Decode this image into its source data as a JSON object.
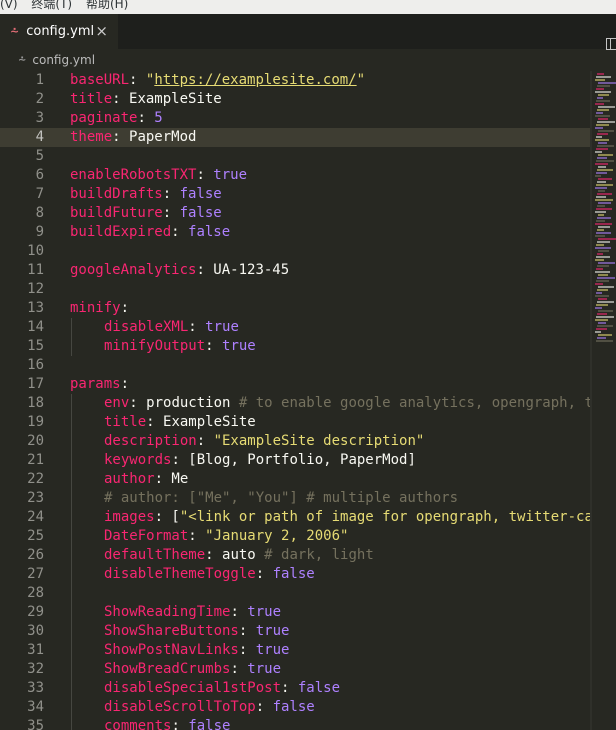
{
  "menubar": {
    "items": [
      "(V)",
      "终端(T)",
      "帮助(H)"
    ]
  },
  "tab": {
    "icon": "yaml-icon",
    "label": "config.yml",
    "close": "×"
  },
  "breadcrumb": {
    "icon": "yaml-icon",
    "label": "config.yml"
  },
  "editor": {
    "current_line": 4,
    "lines": [
      {
        "n": "1",
        "indent": 0,
        "tokens": [
          [
            "key",
            "baseURL"
          ],
          [
            "plain",
            ": "
          ],
          [
            "str",
            "\""
          ],
          [
            "url",
            "https://examplesite.com/"
          ],
          [
            "str",
            "\""
          ]
        ]
      },
      {
        "n": "2",
        "indent": 0,
        "tokens": [
          [
            "key",
            "title"
          ],
          [
            "plain",
            ": ExampleSite"
          ]
        ]
      },
      {
        "n": "3",
        "indent": 0,
        "tokens": [
          [
            "key",
            "paginate"
          ],
          [
            "plain",
            ": "
          ],
          [
            "num",
            "5"
          ]
        ]
      },
      {
        "n": "4",
        "indent": 0,
        "tokens": [
          [
            "key",
            "theme"
          ],
          [
            "plain",
            ": PaperMod"
          ]
        ]
      },
      {
        "n": "5",
        "indent": 0,
        "tokens": []
      },
      {
        "n": "6",
        "indent": 0,
        "tokens": [
          [
            "key",
            "enableRobotsTXT"
          ],
          [
            "plain",
            ": "
          ],
          [
            "num",
            "true"
          ]
        ]
      },
      {
        "n": "7",
        "indent": 0,
        "tokens": [
          [
            "key",
            "buildDrafts"
          ],
          [
            "plain",
            ": "
          ],
          [
            "num",
            "false"
          ]
        ]
      },
      {
        "n": "8",
        "indent": 0,
        "tokens": [
          [
            "key",
            "buildFuture"
          ],
          [
            "plain",
            ": "
          ],
          [
            "num",
            "false"
          ]
        ]
      },
      {
        "n": "9",
        "indent": 0,
        "tokens": [
          [
            "key",
            "buildExpired"
          ],
          [
            "plain",
            ": "
          ],
          [
            "num",
            "false"
          ]
        ]
      },
      {
        "n": "10",
        "indent": 0,
        "tokens": []
      },
      {
        "n": "11",
        "indent": 0,
        "tokens": [
          [
            "key",
            "googleAnalytics"
          ],
          [
            "plain",
            ": UA-123-45"
          ]
        ]
      },
      {
        "n": "12",
        "indent": 0,
        "tokens": []
      },
      {
        "n": "13",
        "indent": 0,
        "tokens": [
          [
            "key",
            "minify"
          ],
          [
            "plain",
            ":"
          ]
        ]
      },
      {
        "n": "14",
        "indent": 1,
        "tokens": [
          [
            "key",
            "disableXML"
          ],
          [
            "plain",
            ": "
          ],
          [
            "num",
            "true"
          ]
        ]
      },
      {
        "n": "15",
        "indent": 1,
        "tokens": [
          [
            "key",
            "minifyOutput"
          ],
          [
            "plain",
            ": "
          ],
          [
            "num",
            "true"
          ]
        ]
      },
      {
        "n": "16",
        "indent": 0,
        "tokens": []
      },
      {
        "n": "17",
        "indent": 0,
        "tokens": [
          [
            "key",
            "params"
          ],
          [
            "plain",
            ":"
          ]
        ]
      },
      {
        "n": "18",
        "indent": 1,
        "tokens": [
          [
            "key",
            "env"
          ],
          [
            "plain",
            ": production "
          ],
          [
            "com",
            "# to enable google analytics, opengraph, t"
          ]
        ]
      },
      {
        "n": "19",
        "indent": 1,
        "tokens": [
          [
            "key",
            "title"
          ],
          [
            "plain",
            ": ExampleSite"
          ]
        ]
      },
      {
        "n": "20",
        "indent": 1,
        "tokens": [
          [
            "key",
            "description"
          ],
          [
            "plain",
            ": "
          ],
          [
            "str",
            "\"ExampleSite description\""
          ]
        ]
      },
      {
        "n": "21",
        "indent": 1,
        "tokens": [
          [
            "key",
            "keywords"
          ],
          [
            "plain",
            ": [Blog, Portfolio, PaperMod]"
          ]
        ]
      },
      {
        "n": "22",
        "indent": 1,
        "tokens": [
          [
            "key",
            "author"
          ],
          [
            "plain",
            ": Me"
          ]
        ]
      },
      {
        "n": "23",
        "indent": 1,
        "tokens": [
          [
            "com",
            "# author: [\"Me\", \"You\"] # multiple authors"
          ]
        ]
      },
      {
        "n": "24",
        "indent": 1,
        "tokens": [
          [
            "key",
            "images"
          ],
          [
            "plain",
            ": ["
          ],
          [
            "str",
            "\"<link or path of image for opengraph, twitter-ca"
          ]
        ]
      },
      {
        "n": "25",
        "indent": 1,
        "tokens": [
          [
            "key",
            "DateFormat"
          ],
          [
            "plain",
            ": "
          ],
          [
            "str",
            "\"January 2, 2006\""
          ]
        ]
      },
      {
        "n": "26",
        "indent": 1,
        "tokens": [
          [
            "key",
            "defaultTheme"
          ],
          [
            "plain",
            ": auto "
          ],
          [
            "com",
            "# dark, light"
          ]
        ]
      },
      {
        "n": "27",
        "indent": 1,
        "tokens": [
          [
            "key",
            "disableThemeToggle"
          ],
          [
            "plain",
            ": "
          ],
          [
            "num",
            "false"
          ]
        ]
      },
      {
        "n": "28",
        "indent": 1,
        "tokens": []
      },
      {
        "n": "29",
        "indent": 1,
        "tokens": [
          [
            "key",
            "ShowReadingTime"
          ],
          [
            "plain",
            ": "
          ],
          [
            "num",
            "true"
          ]
        ]
      },
      {
        "n": "30",
        "indent": 1,
        "tokens": [
          [
            "key",
            "ShowShareButtons"
          ],
          [
            "plain",
            ": "
          ],
          [
            "num",
            "true"
          ]
        ]
      },
      {
        "n": "31",
        "indent": 1,
        "tokens": [
          [
            "key",
            "ShowPostNavLinks"
          ],
          [
            "plain",
            ": "
          ],
          [
            "num",
            "true"
          ]
        ]
      },
      {
        "n": "32",
        "indent": 1,
        "tokens": [
          [
            "key",
            "ShowBreadCrumbs"
          ],
          [
            "plain",
            ": "
          ],
          [
            "num",
            "true"
          ]
        ]
      },
      {
        "n": "33",
        "indent": 1,
        "tokens": [
          [
            "key",
            "disableSpecial1stPost"
          ],
          [
            "plain",
            ": "
          ],
          [
            "num",
            "false"
          ]
        ]
      },
      {
        "n": "34",
        "indent": 1,
        "tokens": [
          [
            "key",
            "disableScrollToTop"
          ],
          [
            "plain",
            ": "
          ],
          [
            "num",
            "false"
          ]
        ]
      },
      {
        "n": "35",
        "indent": 1,
        "tokens": [
          [
            "key",
            "comments"
          ],
          [
            "plain",
            ": "
          ],
          [
            "num",
            "false"
          ]
        ]
      }
    ]
  },
  "colors": {
    "background": "#272822",
    "key": "#f92672",
    "string": "#e6db74",
    "constant": "#ae81ff",
    "comment": "#75715e",
    "text": "#f8f8f2"
  }
}
